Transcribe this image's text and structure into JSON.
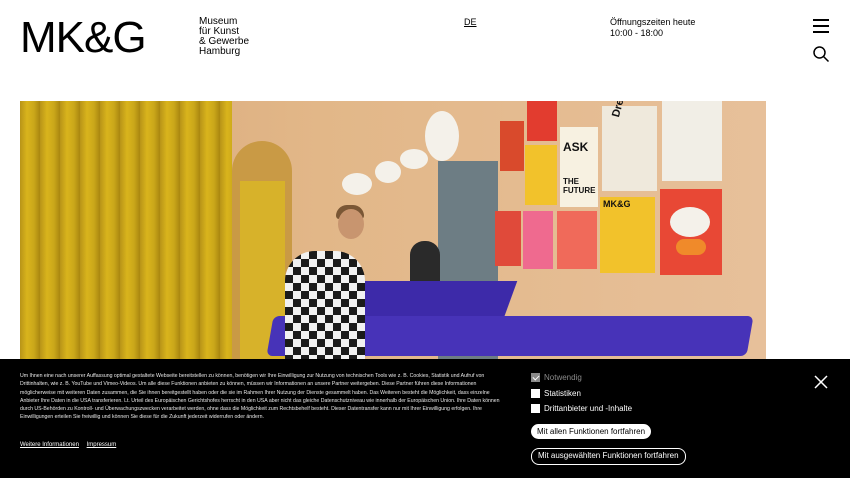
{
  "header": {
    "logo": "MK&G",
    "museum_name_lines": [
      "Museum",
      "für Kunst",
      "& Gewerbe",
      "Hamburg"
    ],
    "language": "DE",
    "hours_label": "Öffnungszeiten heute",
    "hours_value": "10:00 - 18:00",
    "menu_icon": "hamburger-menu-icon",
    "search_icon": "search-icon"
  },
  "hero": {
    "poster_texts": [
      "ASK",
      "THE FUTURE",
      "MK&G",
      "Dressed"
    ]
  },
  "cookie": {
    "text": "Um Ihnen eine nach unserer Auffassung optimal gestaltete Webseite bereitstellen zu können, benötigen wir Ihre Einwilligung zur Nutzung von technischen Tools wie z. B. Cookies, Statistik und Aufruf von Drittinhalten, wie z. B. YouTube und Vimeo-Videos. Um alle diese Funktionen anbieten zu können, müssen wir Informationen an unsere Partner weitergeben. Diese Partner führen diese Informationen möglicherweise mit weiteren Daten zusammen, die Sie ihnen bereitgestellt haben oder die sie im Rahmen Ihrer Nutzung der Dienste gesammelt haben. Das Weiteren besteht die Möglichkeit, dass einzelne Anbieter Ihre Daten in die USA transferieren. Lt. Urteil des Europäischen Gerichtshofes herrscht in den USA aber nicht das gleiche Datenschutzniveau wie innerhalb der Europäischen Union. Ihre Daten können durch US-Behörden zu Kontroll- und Überwachungszwecken verarbeitet werden, ohne dass die Möglichkeit zum Rechtsbehelf besteht. Dieser Datentransfer kann nur mit Ihrer Einwilligung erfolgen. Ihre Einwilligungen erteilen Sie freiwillig und können Sie diese für die Zukunft jederzeit widerrufen oder ändern.",
    "link_more": "Weitere Informationen",
    "link_imprint": "Impressum",
    "options": [
      {
        "label": "Notwendig",
        "checked": true,
        "disabled": true
      },
      {
        "label": "Statistiken",
        "checked": false,
        "disabled": false
      },
      {
        "label": "Drittanbieter und -Inhalte",
        "checked": false,
        "disabled": false
      }
    ],
    "accept_all_label": "Mit allen Funktionen fortfahren",
    "accept_selected_label": "Mit ausgewählten Funktionen fortfahren",
    "close_icon": "close-icon"
  }
}
